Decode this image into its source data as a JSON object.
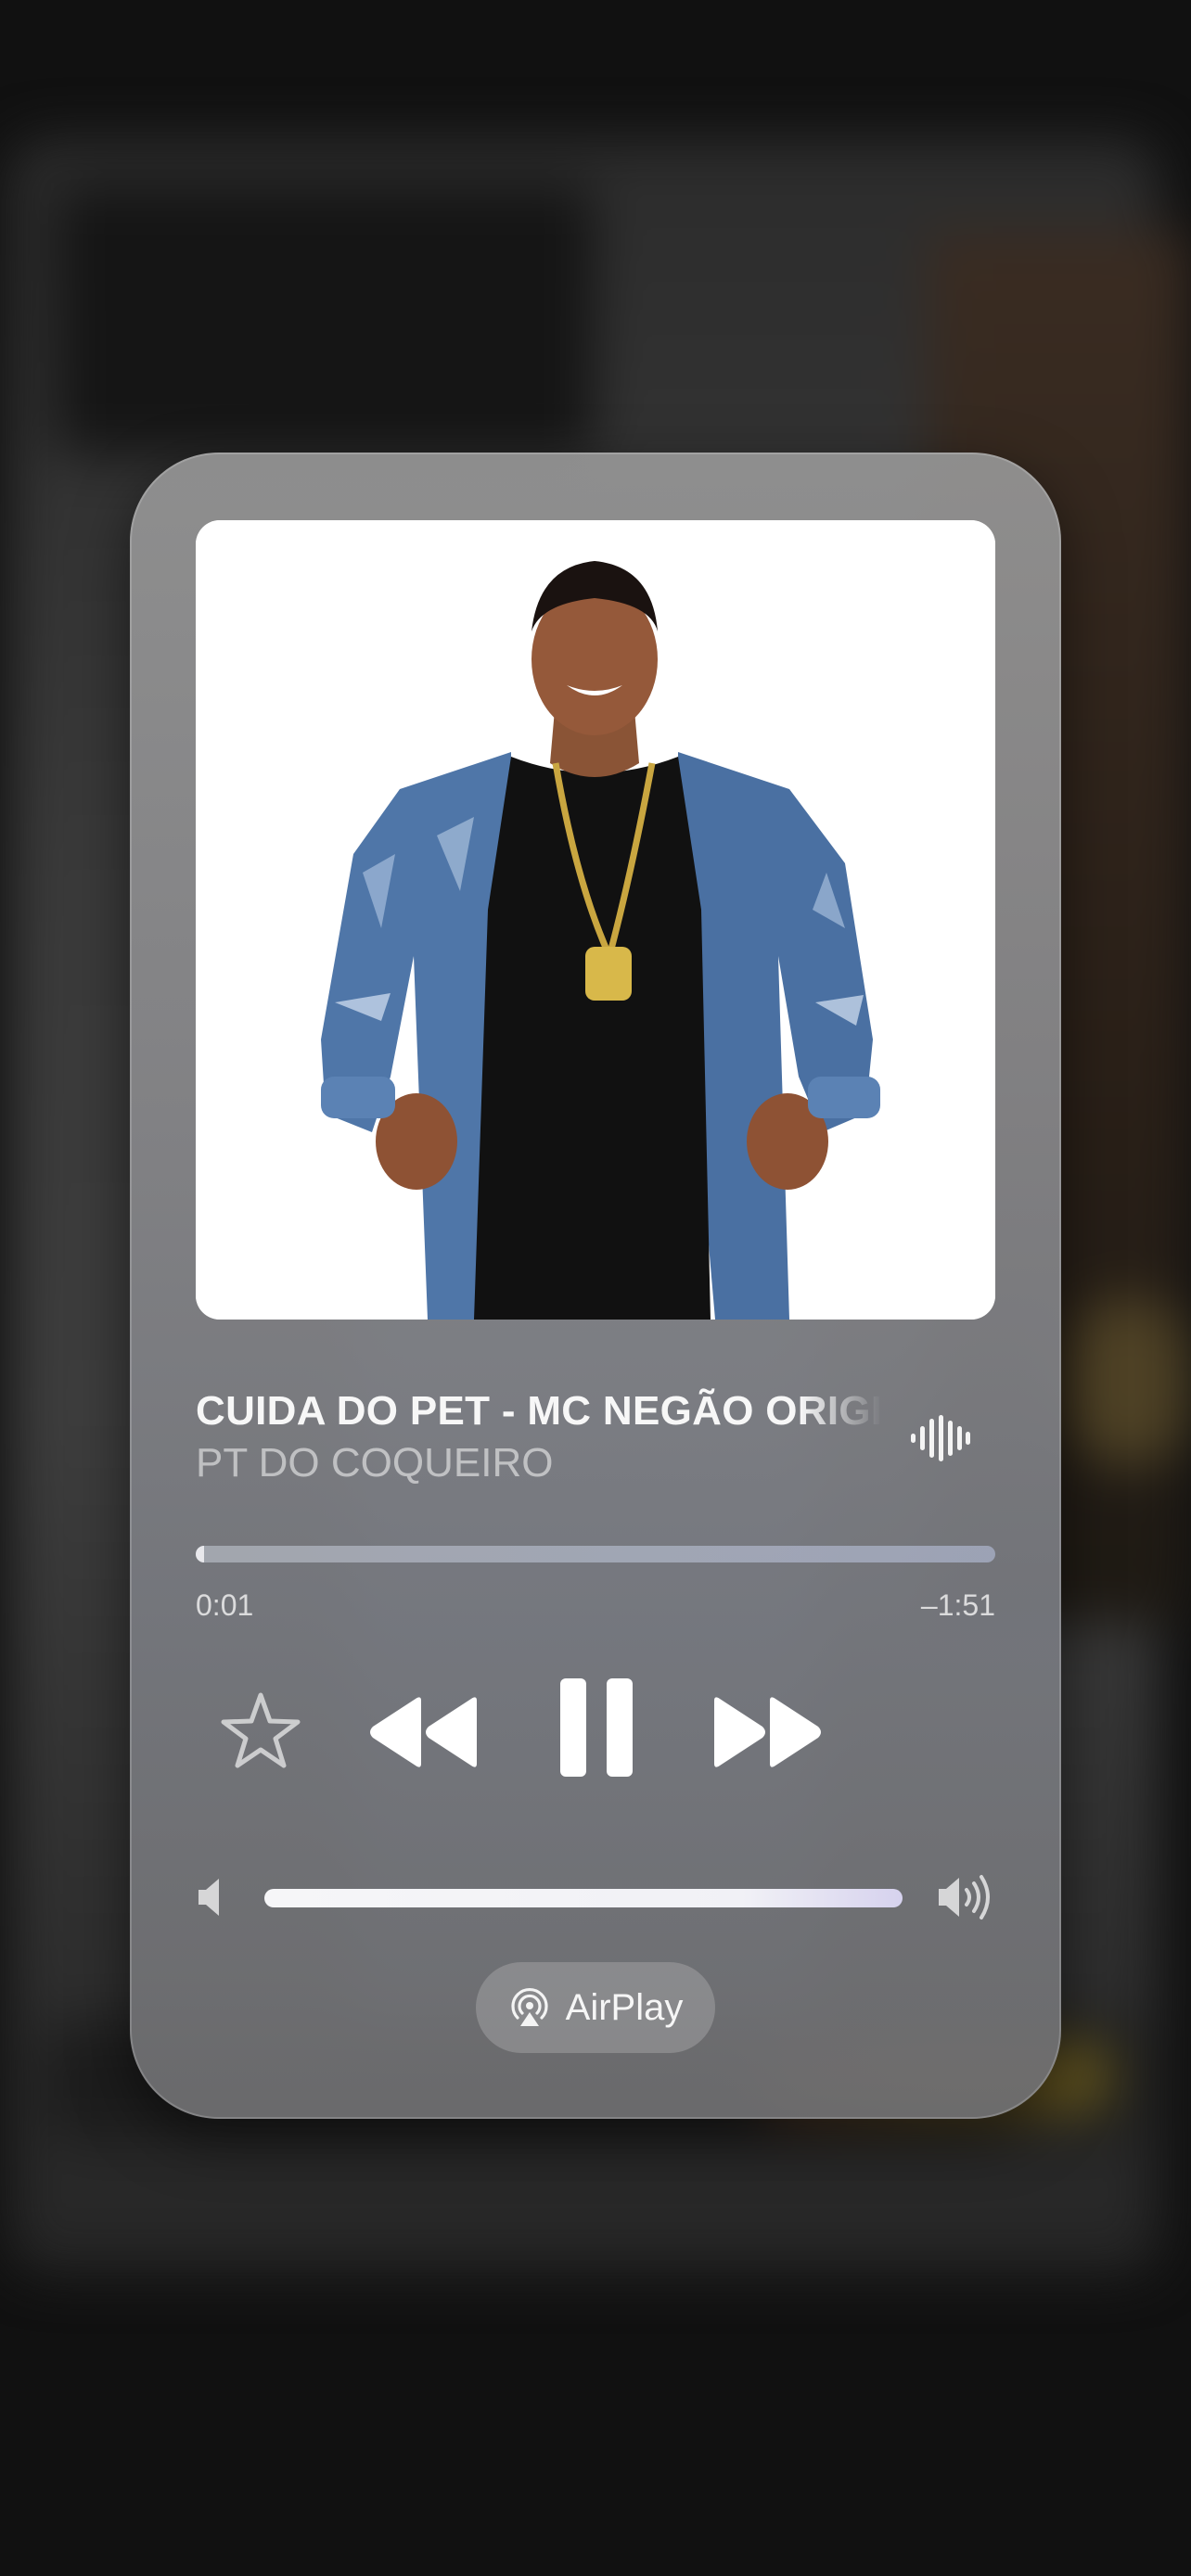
{
  "now_playing": {
    "title": "CUIDA DO PET - MC NEGÃO ORIGINAL",
    "artist": "PT DO COQUEIRO",
    "artwork_description_icon": "album-artwork",
    "elapsed": "0:01",
    "remaining": "–1:51",
    "progress_fraction": 0.01,
    "volume_fraction": 1.0
  },
  "controls": {
    "favorite_icon": "star-icon",
    "rewind_icon": "rewind-icon",
    "pause_icon": "pause-icon",
    "forward_icon": "fast-forward-icon",
    "playing_indicator_icon": "waveform-icon"
  },
  "airplay": {
    "label": "AirPlay",
    "icon": "airplay-icon"
  },
  "colors": {
    "card_background": "#8a8a8c",
    "text_primary": "#f7f7f7",
    "text_secondary": "#bdbdbd",
    "app_background": "#121212"
  }
}
